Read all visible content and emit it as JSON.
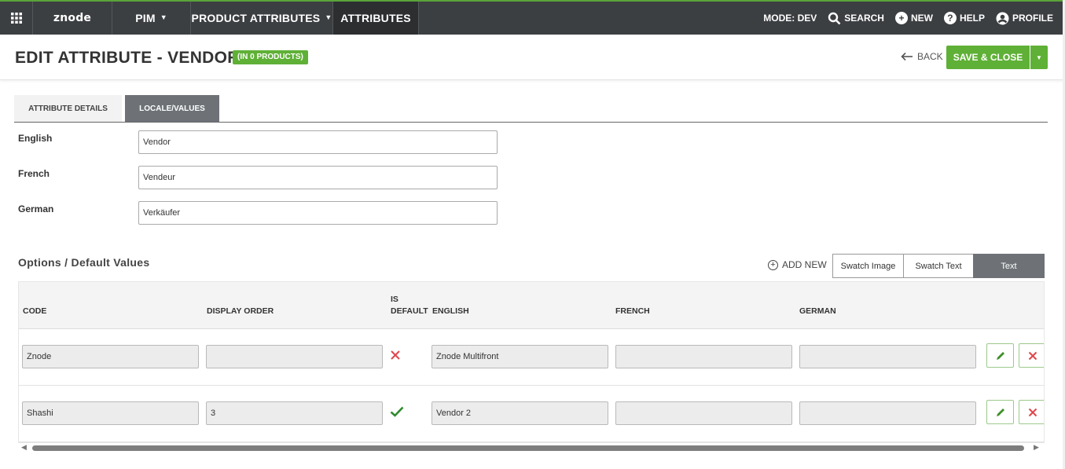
{
  "nav": {
    "logo": "znode",
    "pim": "PIM",
    "product_attributes": "PRODUCT ATTRIBUTES",
    "attributes": "ATTRIBUTES",
    "mode": "MODE: DEV",
    "search": "SEARCH",
    "new": "NEW",
    "help": "HELP",
    "profile": "PROFILE"
  },
  "header": {
    "title": "EDIT ATTRIBUTE - VENDOR",
    "badge": "(IN 0 PRODUCTS)",
    "back": "BACK",
    "save_close": "SAVE & CLOSE"
  },
  "tabs": [
    {
      "label": "ATTRIBUTE DETAILS"
    },
    {
      "label": "LOCALE/VALUES"
    }
  ],
  "locales": [
    {
      "label": "English",
      "value": "Vendor"
    },
    {
      "label": "French",
      "value": "Vendeur"
    },
    {
      "label": "German",
      "value": "Verkäufer"
    }
  ],
  "options": {
    "title": "Options / Default Values",
    "add_new": "ADD NEW",
    "swatch_image": "Swatch Image",
    "swatch_text": "Swatch Text",
    "text": "Text",
    "columns": {
      "code": "CODE",
      "display_order": "DISPLAY ORDER",
      "is_default_1": "IS",
      "is_default_2": "DEFAULT",
      "english": "ENGLISH",
      "french": "FRENCH",
      "german": "GERMAN"
    },
    "rows": [
      {
        "code": "Znode",
        "display_order": "",
        "is_default": false,
        "english": "Znode Multifront",
        "french": "",
        "german": ""
      },
      {
        "code": "Shashi",
        "display_order": "3",
        "is_default": true,
        "english": "Vendor 2",
        "french": "",
        "german": ""
      }
    ]
  },
  "colors": {
    "accent_green": "#5fb036",
    "nav_bg": "#3c3f42",
    "delete_red": "#e0474c",
    "check_green": "#2e8b2e"
  }
}
